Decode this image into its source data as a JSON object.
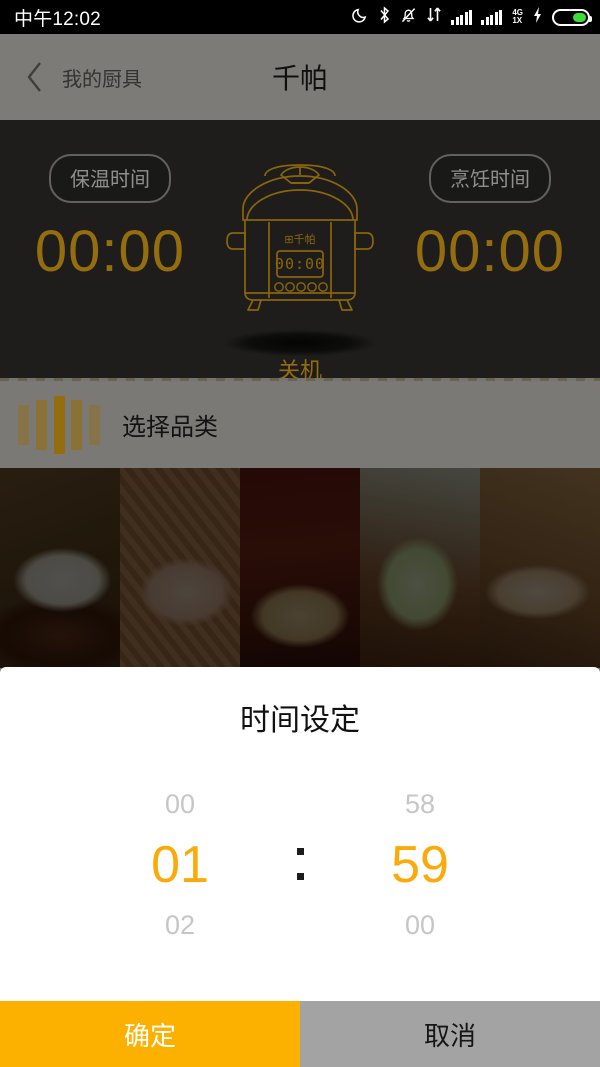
{
  "status_bar": {
    "time": "中午12:02",
    "icons": [
      {
        "name": "moon-dnd-icon"
      },
      {
        "name": "bluetooth-icon"
      },
      {
        "name": "bell-muted-icon"
      },
      {
        "name": "data-transfer-icon"
      },
      {
        "name": "signal-bars-icon"
      },
      {
        "name": "network-type-icon"
      },
      {
        "name": "charging-bolt-icon"
      },
      {
        "name": "battery-icon"
      }
    ],
    "network_primary": "4G",
    "network_secondary": "1X"
  },
  "header": {
    "back_label": "我的厨具",
    "title": "千帕"
  },
  "device": {
    "keep_warm": {
      "label": "保温时间",
      "value": "00:00"
    },
    "cooking": {
      "label": "烹饪时间",
      "value": "00:00"
    },
    "appliance_display": "00:00",
    "appliance_brand": "千帕",
    "power_state": "关机"
  },
  "category": {
    "title": "选择品类",
    "thumbs": [
      {
        "name": "category-rice"
      },
      {
        "name": "category-soup"
      },
      {
        "name": "category-stew"
      },
      {
        "name": "category-vegetable"
      },
      {
        "name": "category-bread"
      }
    ]
  },
  "dialog": {
    "title": "时间设定",
    "hours": {
      "prev": "00",
      "selected": "01",
      "next": "02"
    },
    "minutes": {
      "prev": "58",
      "selected": "59",
      "next": "00"
    },
    "separator": ":",
    "confirm_label": "确定",
    "cancel_label": "取消"
  },
  "colors": {
    "accent_amber": "#d49c16",
    "picker_orange": "#fcaa0b",
    "confirm_button": "#fcb000",
    "cancel_button": "#a3a3a3",
    "device_panel": "#2b2a28"
  }
}
